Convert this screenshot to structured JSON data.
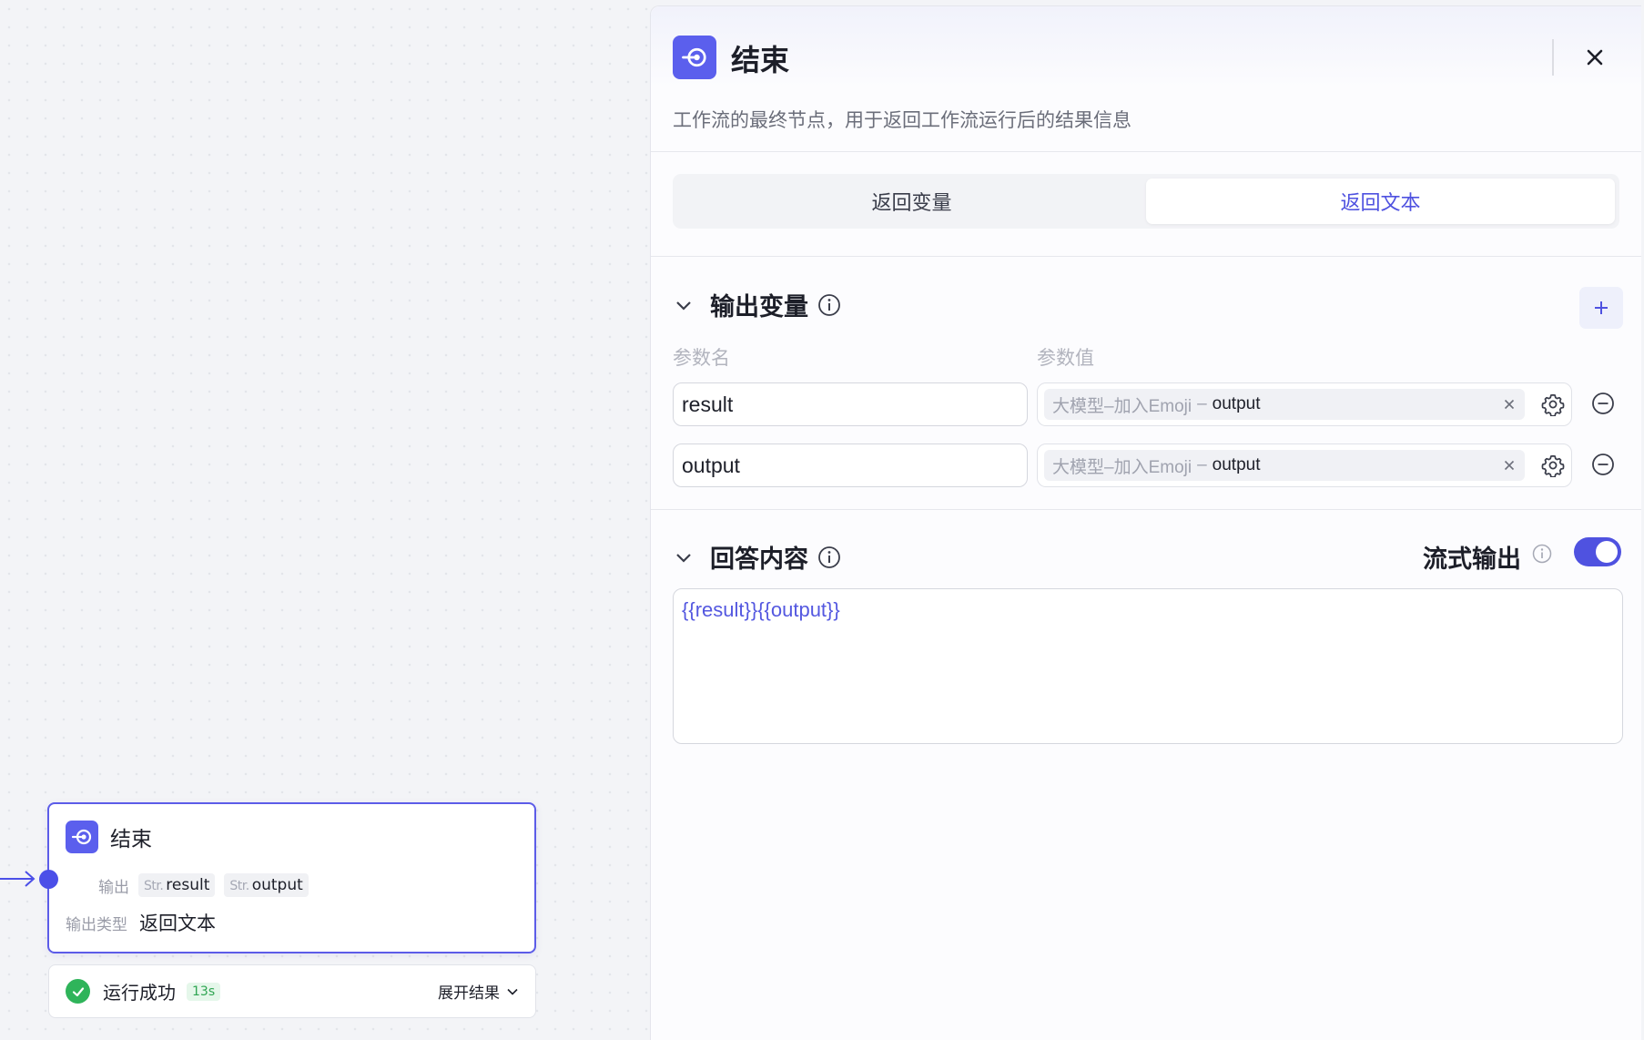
{
  "canvas": {
    "node": {
      "title": "结束",
      "output_label": "输出",
      "output_tags": [
        {
          "type": "Str.",
          "name": "result"
        },
        {
          "type": "Str.",
          "name": "output"
        }
      ],
      "output_type_label": "输出类型",
      "output_type_value": "返回文本"
    },
    "run_status": {
      "text": "运行成功",
      "time": "13s",
      "expand_label": "展开结果"
    }
  },
  "panel": {
    "title": "结束",
    "description": "工作流的最终节点，用于返回工作流运行后的结果信息",
    "tabs": [
      {
        "label": "返回变量",
        "active": false
      },
      {
        "label": "返回文本",
        "active": true
      }
    ],
    "output_section": {
      "title": "输出变量",
      "col_name": "参数名",
      "col_value": "参数值",
      "rows": [
        {
          "name": "result",
          "ref_source": "大模型–加入Emoji",
          "ref_sep": "–",
          "ref_var": "output"
        },
        {
          "name": "output",
          "ref_source": "大模型–加入Emoji",
          "ref_sep": "–",
          "ref_var": "output"
        }
      ]
    },
    "answer_section": {
      "title": "回答内容",
      "stream_label": "流式输出",
      "stream_enabled": true,
      "content": "{{result}}{{output}}"
    }
  },
  "colors": {
    "accent": "#4f52e0",
    "node_icon_bg": "#5b5fed",
    "success": "#2fb45a"
  }
}
